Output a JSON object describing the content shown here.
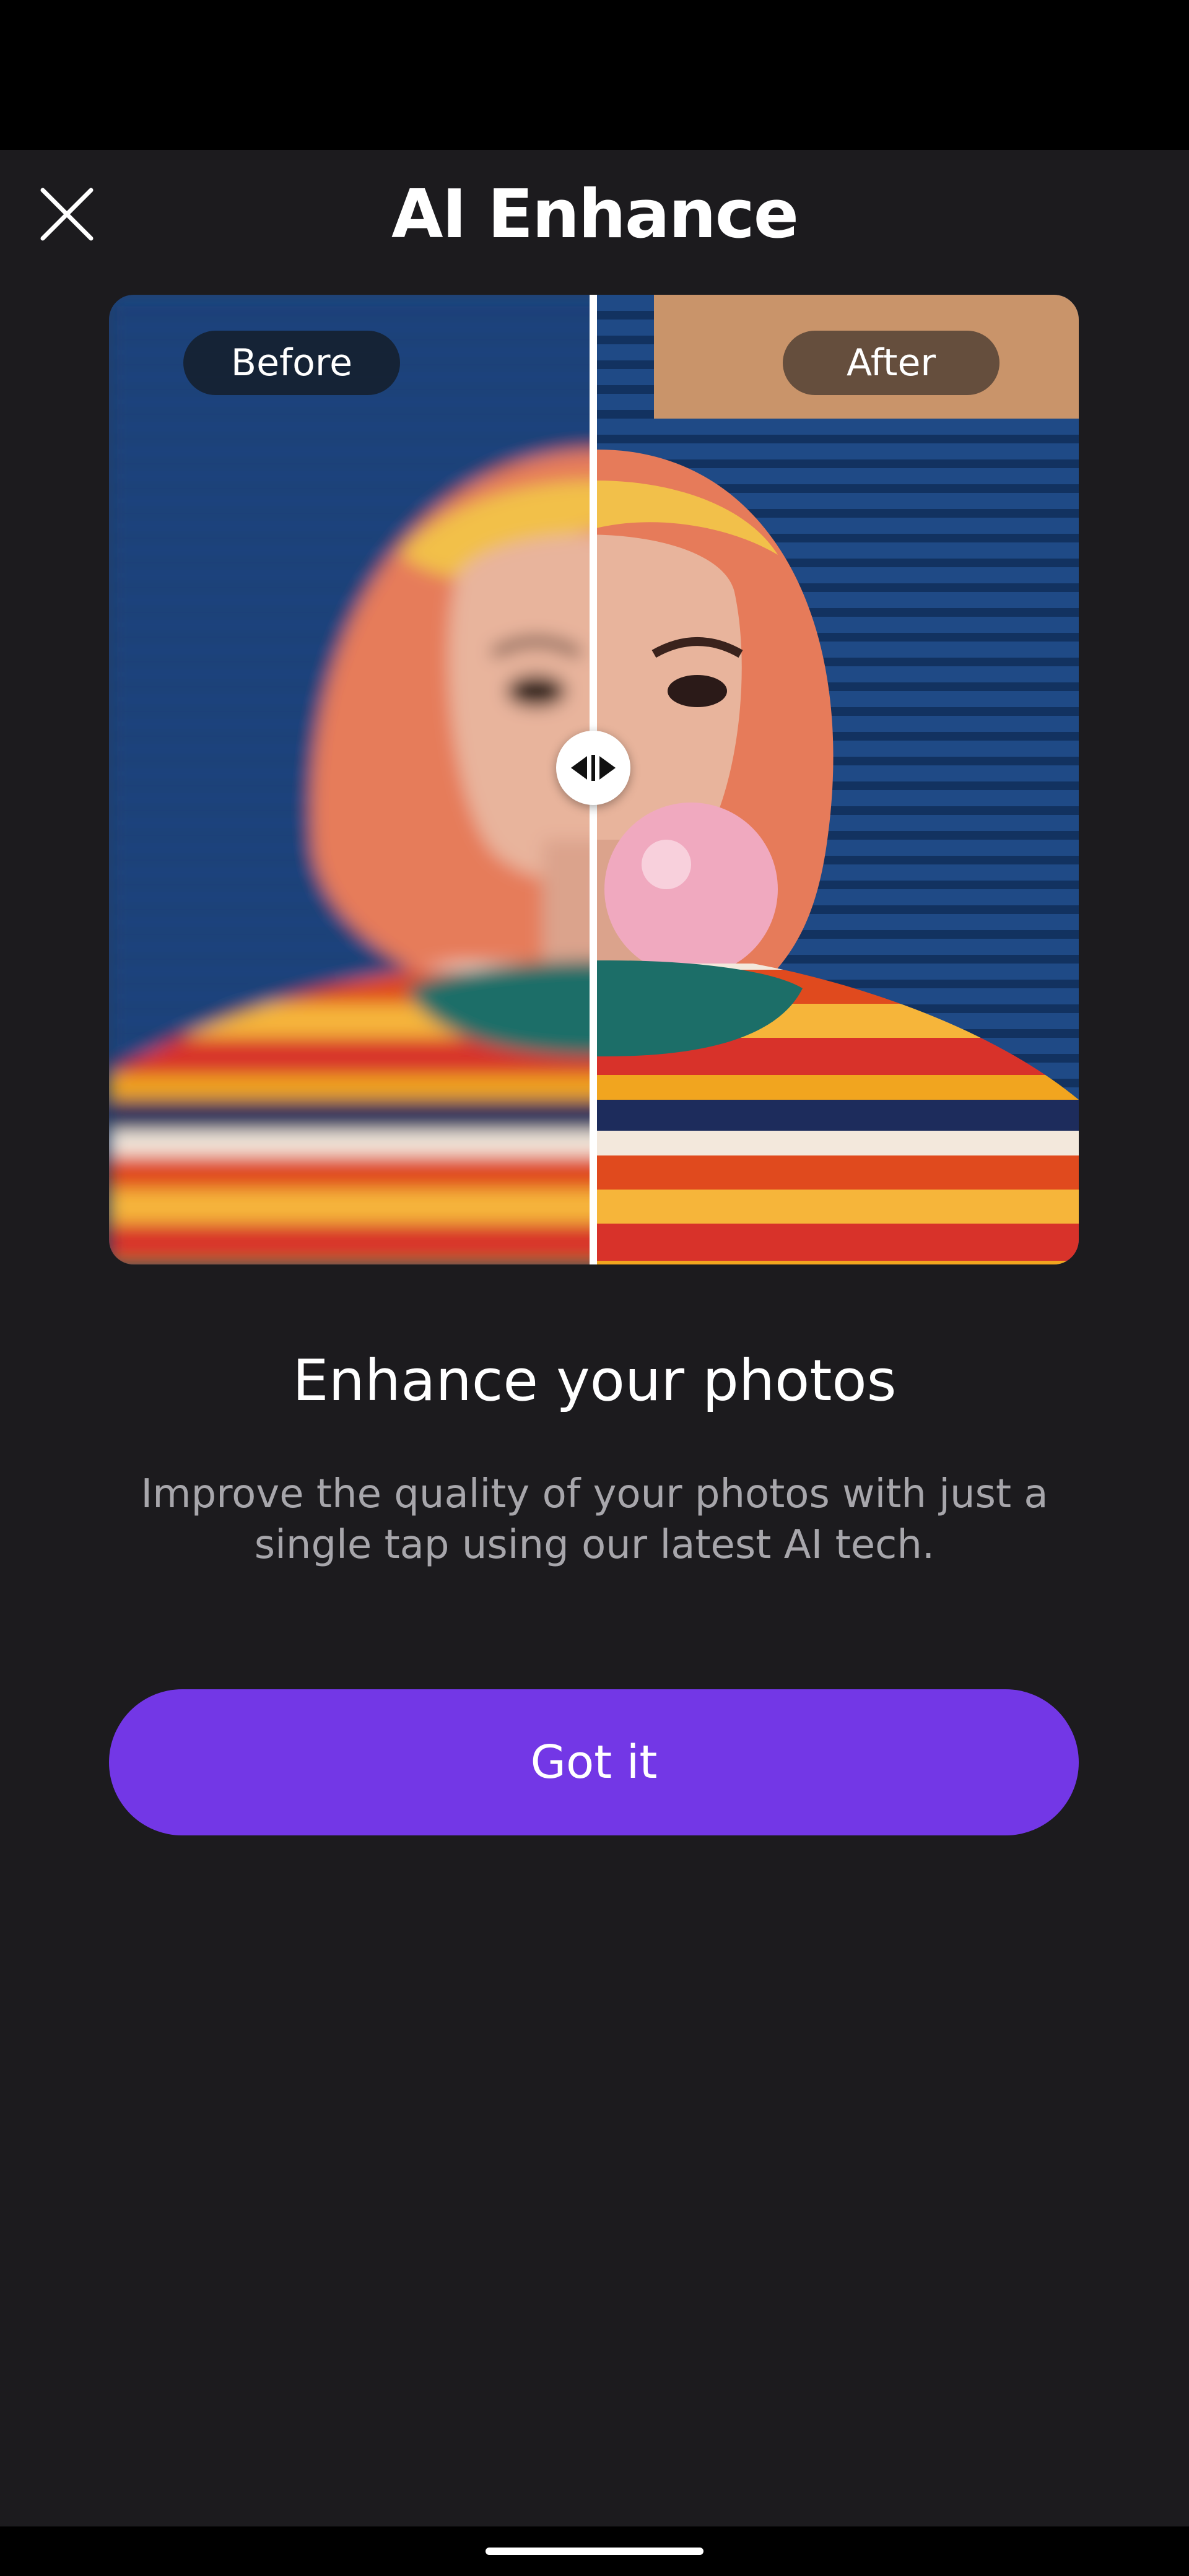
{
  "header": {
    "title": "AI Enhance",
    "close_icon": "close-icon"
  },
  "comparison": {
    "before_label": "Before",
    "after_label": "After",
    "handle_icon": "compare-arrows-icon",
    "split_position": 0.5
  },
  "content": {
    "heading": "Enhance your photos",
    "description": "Improve the quality of your photos with just a single tap using our latest AI tech."
  },
  "actions": {
    "primary_label": "Got it"
  },
  "colors": {
    "background": "#1c1b1e",
    "accent": "#7337e6",
    "text_primary": "#ffffff",
    "text_secondary": "#a7a6ab"
  }
}
